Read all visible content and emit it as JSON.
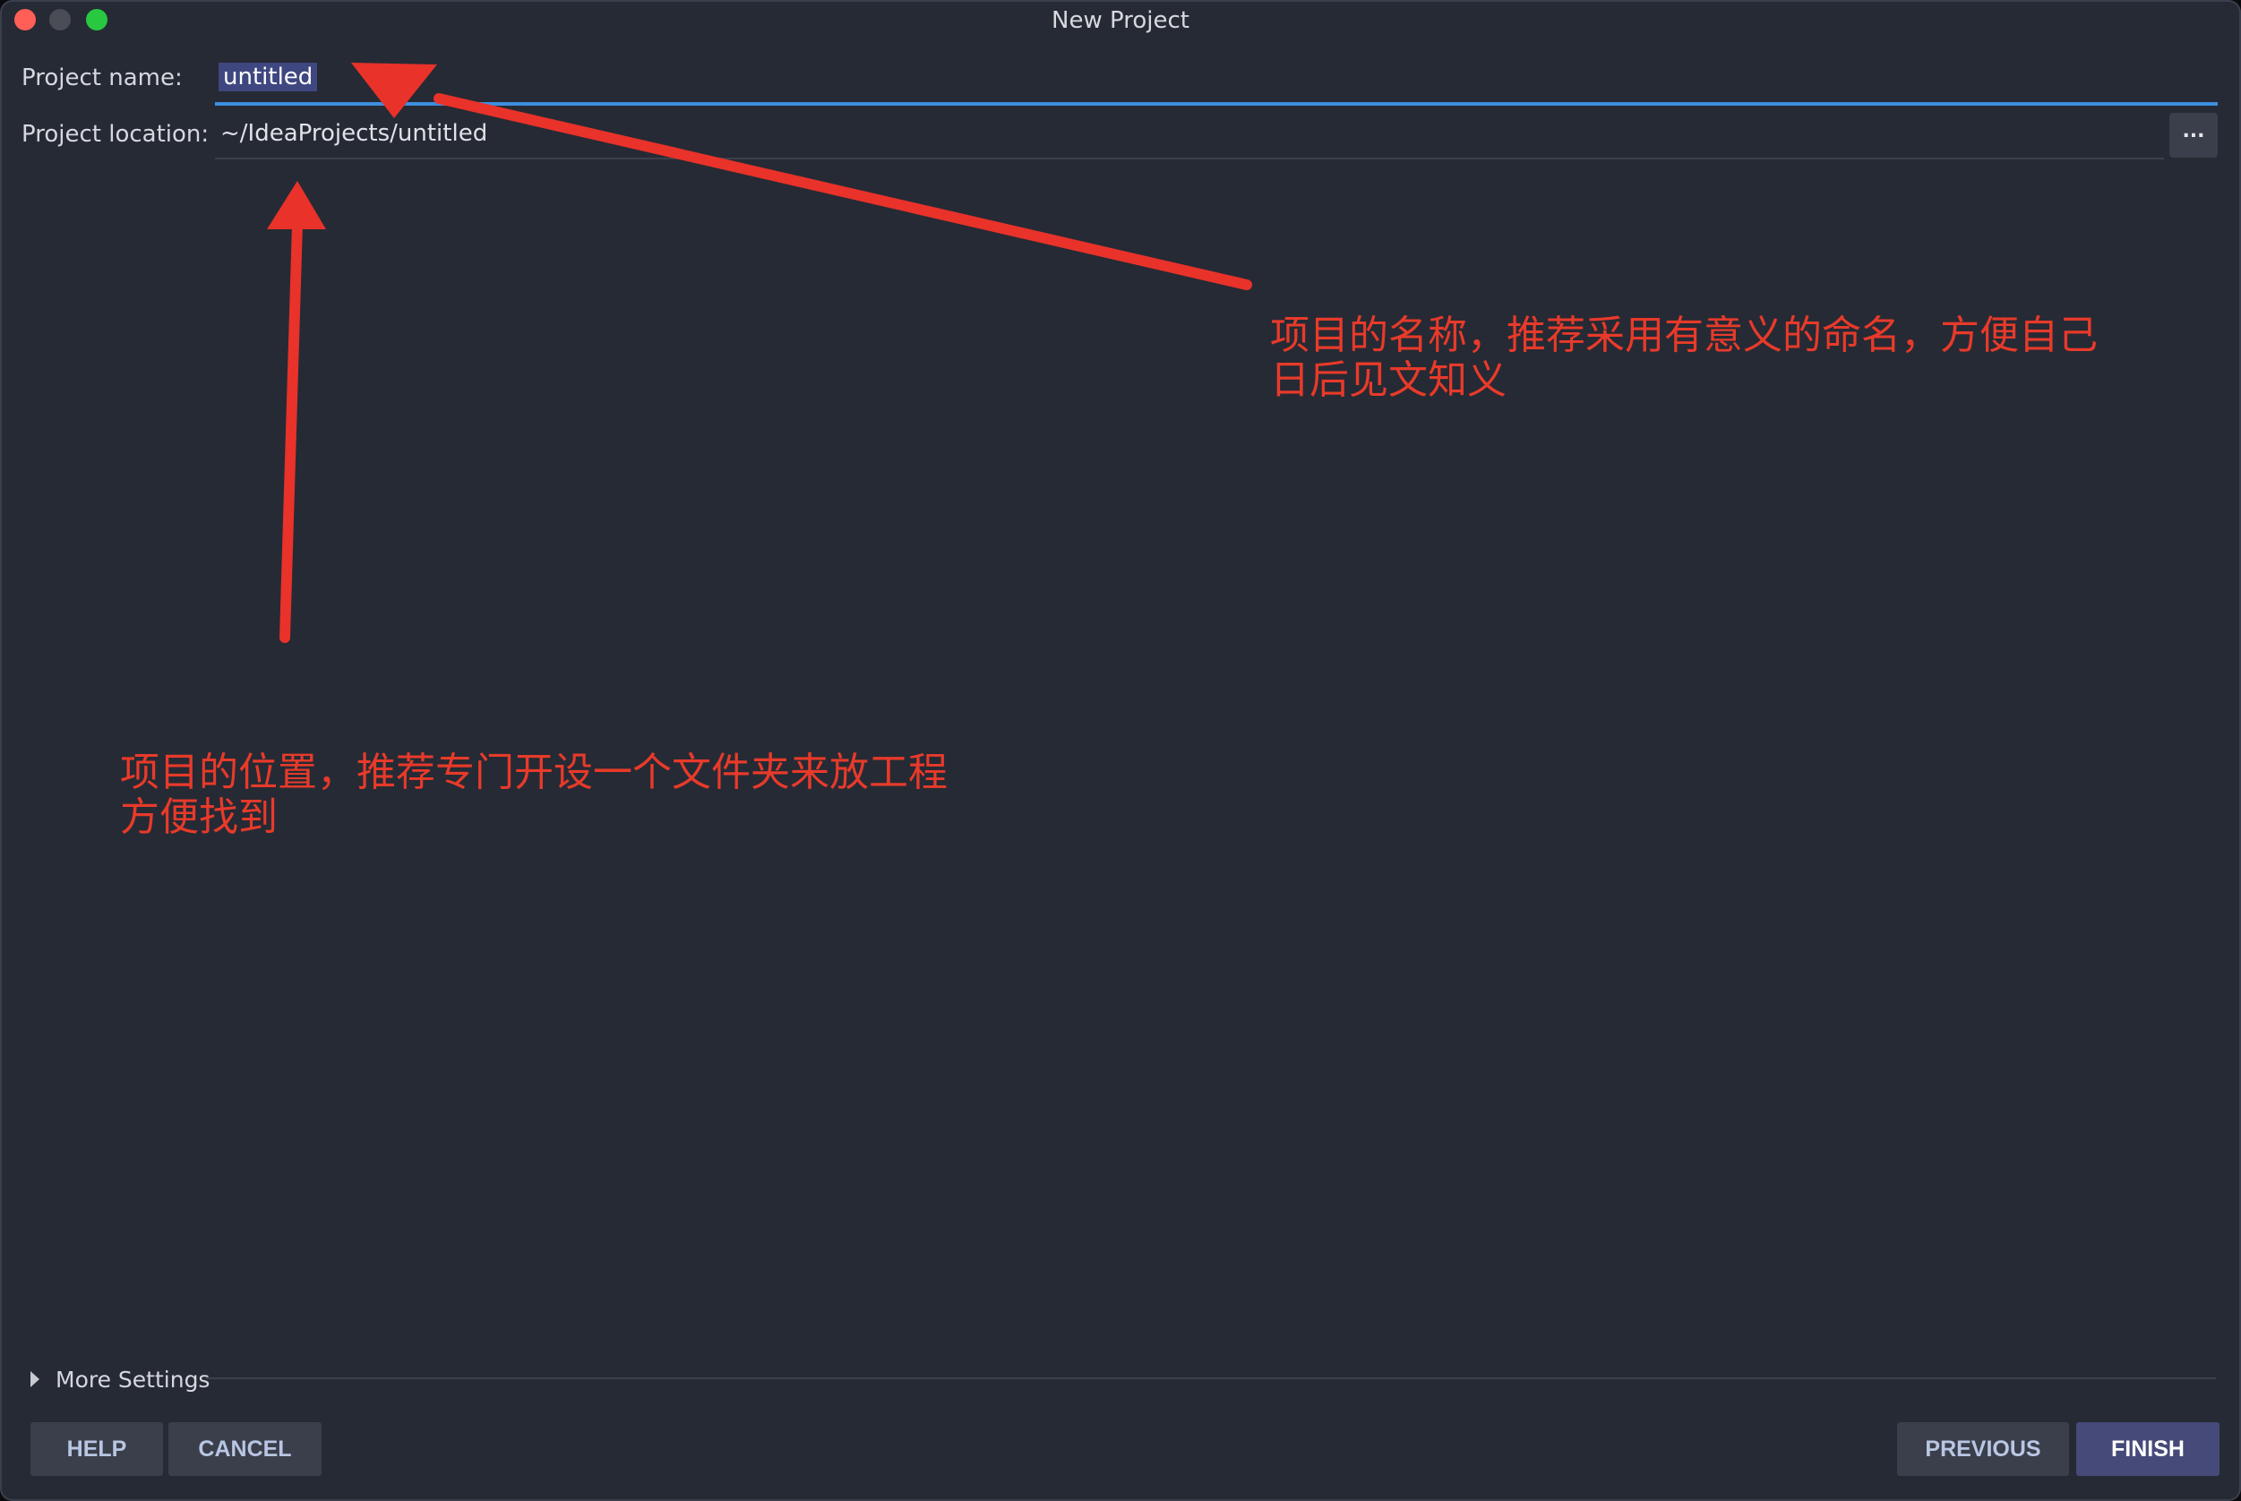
{
  "window": {
    "title": "New Project"
  },
  "form": {
    "project_name_label": "Project name:",
    "project_name_value": "untitled",
    "project_location_label": "Project location:",
    "project_location_value": "~/IdeaProjects/untitled",
    "browse_label": "..."
  },
  "more_settings": {
    "label": "More Settings"
  },
  "buttons": {
    "help": "HELP",
    "cancel": "CANCEL",
    "previous": "PREVIOUS",
    "finish": "FINISH"
  },
  "annotations": {
    "name_note_line1": "项目的名称，推荐采用有意义的命名，方便自己",
    "name_note_line2": "日后见文知义",
    "location_note_line1": "项目的位置，推荐专门开设一个文件夹来放工程",
    "location_note_line2": "方便找到",
    "arrow_color": "#e8322a"
  },
  "colors": {
    "window_bg": "#262a34",
    "focus_underline": "#3d8ee0",
    "finish_button": "#454a78"
  }
}
